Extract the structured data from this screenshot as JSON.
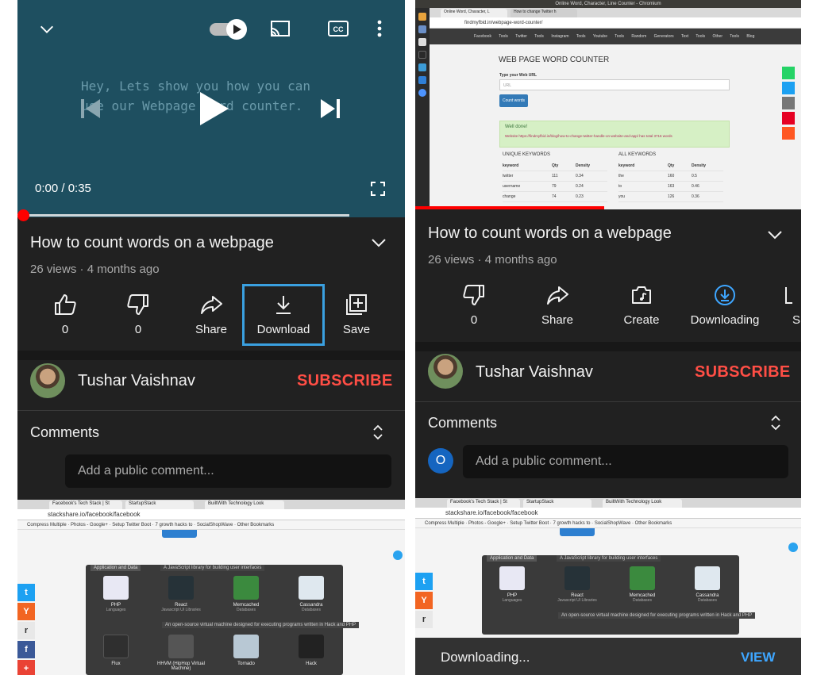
{
  "left": {
    "video": {
      "overlay_text": "Hey, Lets show you how you can\nuse our Webpage word counter.",
      "time": "0:00 / 0:35",
      "progress": 0.0,
      "icons": [
        "chevron-down-icon",
        "autoplay-toggle-icon",
        "cast-icon",
        "captions-icon",
        "more-vert-icon",
        "previous-icon",
        "play-icon",
        "next-icon",
        "fullscreen-icon"
      ]
    },
    "title": "How to count words on a webpage",
    "meta": "26 views · 4 months ago",
    "actions": [
      {
        "label": "0",
        "icon": "thumbs-up-icon"
      },
      {
        "label": "0",
        "icon": "thumbs-down-icon"
      },
      {
        "label": "Share",
        "icon": "share-icon"
      },
      {
        "label": "Download",
        "icon": "download-icon"
      },
      {
        "label": "Save",
        "icon": "save-to-playlist-icon"
      }
    ],
    "channel": {
      "name": "Tushar Vaishnav",
      "subscribe": "SUBSCRIBE"
    },
    "comments": {
      "heading": "Comments",
      "placeholder": "Add a public comment..."
    },
    "preview": {
      "tabs": [
        "Facebook's Tech Stack | St",
        "StartupStack",
        "BuiltWith Technology Look"
      ],
      "url": "stackshare.io/facebook/facebook",
      "bookmarks": "Compress Multiple  ·  Photos - Google+  ·  Setup Twitter Boot  ·  7 growth hacks to  ·  SocialShopWave  ·  Other Bookmarks",
      "header_label": "Application and Data",
      "tooltip": "A JavaScript library for building user interfaces",
      "footer": "An open-source virtual machine designed for executing programs written in Hack and PHP",
      "techs": [
        {
          "name": "PHP",
          "cat": "Languages"
        },
        {
          "name": "React",
          "cat": "Javascript UI Libraries"
        },
        {
          "name": "Memcached",
          "cat": "Databases"
        },
        {
          "name": "Cassandra",
          "cat": "Databases"
        },
        {
          "name": "Flux",
          "cat": ""
        },
        {
          "name": "HHVM (HipHop Virtual Machine)",
          "cat": ""
        },
        {
          "name": "Tornado",
          "cat": ""
        },
        {
          "name": "Hack",
          "cat": ""
        }
      ]
    }
  },
  "right": {
    "video": {
      "window_title": "Online Word, Character, Line Counter - Chromium",
      "tabs": [
        "Online Word, Character, L",
        "How to change Twitter h"
      ],
      "url": "findmyfbid.in/webpage-word-counter/",
      "nav": "Facebook Tools  Twitter Tools  Instagram Tools  Youtube Tools  Random Generators  Text Tools  Other Tools  Blog",
      "heading": "WEB PAGE WORD COUNTER",
      "field_label": "Type your Web URL",
      "field_placeholder": "URL",
      "button": "Count words",
      "alert_title": "Well done!",
      "alert_text": "Website https://findmyfbid.in/blog/how-to-change-twitter-handle-on-website-and-app/ has total 3716 words",
      "unique_heading": "UNIQUE KEYWORDS",
      "all_heading": "ALL KEYWORDS",
      "table_headers": [
        "keyword",
        "Qty",
        "Density"
      ],
      "unique_rows": [
        [
          "twitter",
          "111",
          "0.34"
        ],
        [
          "username",
          "79",
          "0.24"
        ],
        [
          "change",
          "74",
          "0.23"
        ]
      ],
      "all_rows": [
        [
          "the",
          "160",
          "0.5"
        ],
        [
          "to",
          "163",
          "0.46"
        ],
        [
          "you",
          "126",
          "0.36"
        ]
      ],
      "progress": 0.49
    },
    "title": "How to count words on a webpage",
    "meta": "26 views · 4 months ago",
    "actions": [
      {
        "label": "0",
        "icon": "thumbs-down-icon"
      },
      {
        "label": "Share",
        "icon": "share-icon"
      },
      {
        "label": "Create",
        "icon": "create-icon"
      },
      {
        "label": "Downloading",
        "icon": "downloading-icon"
      },
      {
        "label": "S",
        "icon": "save-icon"
      }
    ],
    "channel": {
      "name": "Tushar Vaishnav",
      "subscribe": "SUBSCRIBE"
    },
    "comments": {
      "heading": "Comments",
      "avatar_letter": "O",
      "placeholder": "Add a public comment..."
    },
    "preview": {
      "tabs": [
        "Facebook's Tech Stack | St",
        "StartupStack",
        "BuiltWith Technology Look"
      ],
      "url": "stackshare.io/facebook/facebook",
      "bookmarks": "Compress Multiple  ·  Photos - Google+  ·  Setup Twitter Boot  ·  7 growth hacks to  ·  SocialShopWave  ·  Other Bookmarks",
      "header_label": "Application and Data",
      "tooltip": "A JavaScript library for building user interfaces",
      "footer": "An open-source virtual machine designed for executing programs written in Hack and PHP",
      "techs": [
        {
          "name": "PHP",
          "cat": "Languages"
        },
        {
          "name": "React",
          "cat": "Javascript UI Libraries"
        },
        {
          "name": "Memcached",
          "cat": "Databases"
        },
        {
          "name": "Cassandra",
          "cat": "Databases"
        }
      ]
    },
    "snackbar": {
      "text": "Downloading...",
      "action": "VIEW"
    }
  },
  "colors": {
    "subscribe": "#ff4e45",
    "background": "#212121",
    "highlight": "#3aa0e0",
    "progress": "#ff0000",
    "snackbar_action": "#3ea6ff"
  }
}
